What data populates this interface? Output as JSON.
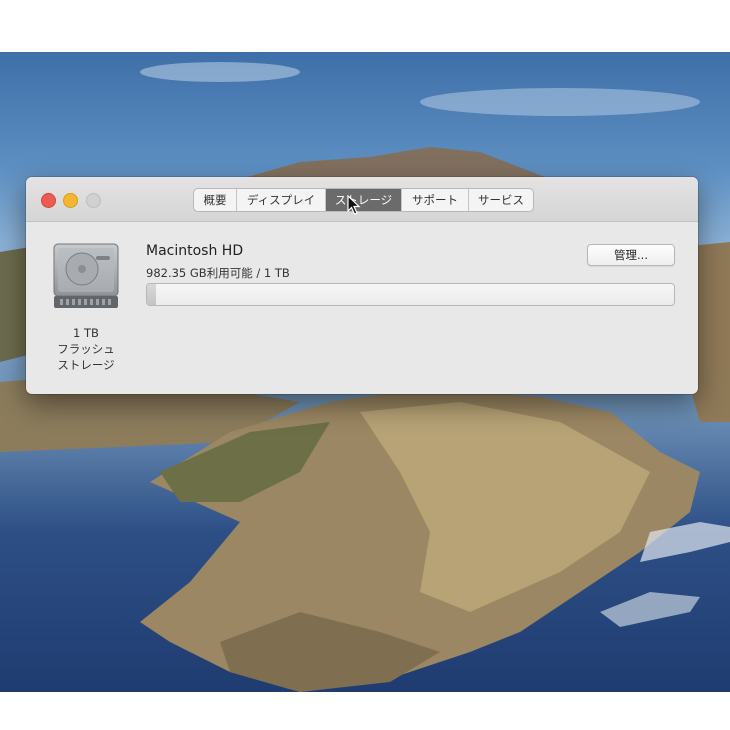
{
  "window": {
    "controls": [
      "close",
      "minimize",
      "zoom"
    ],
    "tabs": [
      {
        "label": "概要",
        "active": false
      },
      {
        "label": "ディスプレイ",
        "active": false
      },
      {
        "label": "ストレージ",
        "active": true
      },
      {
        "label": "サポート",
        "active": false
      },
      {
        "label": "サービス",
        "active": false
      }
    ]
  },
  "storage": {
    "disk_caption_line1": "1 TB",
    "disk_caption_line2": "フラッシュ",
    "disk_caption_line3": "ストレージ",
    "volume_name": "Macintosh HD",
    "available_text": "982.35 GB利用可能 / 1 TB",
    "manage_button_label": "管理...",
    "used_fraction": 0.018,
    "disk_icon": "hard-drive-icon"
  },
  "colors": {
    "close": "#ec5b54",
    "minimize": "#f0b72f",
    "zoom": "#d2d1d1",
    "active_tab": "#6c6b6b"
  }
}
